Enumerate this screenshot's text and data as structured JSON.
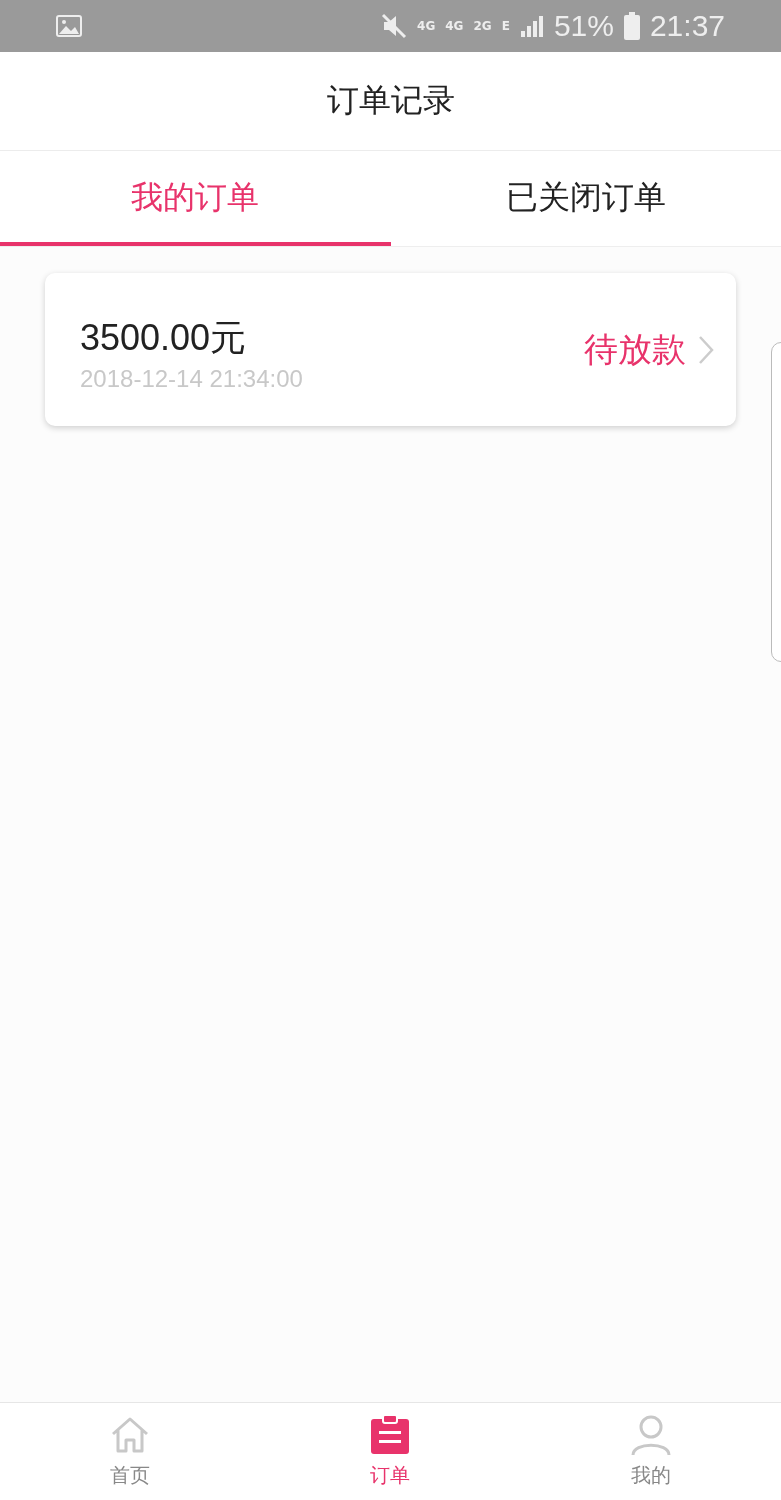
{
  "status_bar": {
    "network_labels": [
      "4G",
      "4G",
      "2G",
      "E"
    ],
    "battery": "51%",
    "time": "21:37"
  },
  "header": {
    "title": "订单记录"
  },
  "tabs": [
    {
      "label": "我的订单",
      "selected": true
    },
    {
      "label": "已关闭订单",
      "selected": false
    }
  ],
  "orders": [
    {
      "amount": "3500.00元",
      "date": "2018-12-14 21:34:00",
      "status": "待放款"
    }
  ],
  "bottom_nav": [
    {
      "label": "首页",
      "kind": "home",
      "selected": false
    },
    {
      "label": "订单",
      "kind": "orders",
      "selected": true
    },
    {
      "label": "我的",
      "kind": "profile",
      "selected": false
    }
  ]
}
